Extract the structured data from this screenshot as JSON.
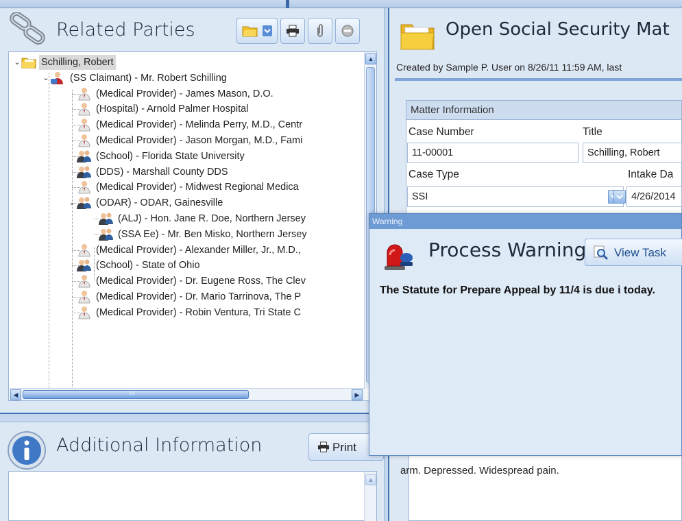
{
  "related_parties": {
    "title": "Related Parties",
    "rows": [
      {
        "label": "Schilling, Robert",
        "level": 0,
        "icon": "folder-icon",
        "expanded": true,
        "selected": true
      },
      {
        "label": "(SS Claimant) - Mr. Robert Schilling",
        "level": 1,
        "icon": "claimant-icon",
        "expanded": true
      },
      {
        "label": "(Medical Provider) - James Mason, D.O.",
        "level": 2,
        "icon": "doctor-icon"
      },
      {
        "label": "(Hospital) - Arnold Palmer Hospital",
        "level": 2,
        "icon": "doctor-icon"
      },
      {
        "label": "(Medical Provider) - Melinda Perry, M.D., Centr",
        "level": 2,
        "icon": "doctor-icon"
      },
      {
        "label": "(Medical Provider) - Jason Morgan, M.D., Fami",
        "level": 2,
        "icon": "doctor-icon"
      },
      {
        "label": "(School) - Florida State University",
        "level": 2,
        "icon": "organization-icon"
      },
      {
        "label": "(DDS) - Marshall County DDS",
        "level": 2,
        "icon": "organization-icon"
      },
      {
        "label": "(Medical Provider) - Midwest Regional Medica",
        "level": 2,
        "icon": "doctor-icon"
      },
      {
        "label": "(ODAR) - ODAR, Gainesville",
        "level": 2,
        "icon": "organization-icon",
        "expanded": true
      },
      {
        "label": "(ALJ) - Hon. Jane R. Doe, Northern Jersey",
        "level": 3,
        "icon": "organization-icon"
      },
      {
        "label": "(SSA Ee) - Mr. Ben Misko, Northern Jersey",
        "level": 3,
        "icon": "organization-icon"
      },
      {
        "label": "(Medical Provider) - Alexander Miller, Jr., M.D.,",
        "level": 2,
        "icon": "doctor-icon"
      },
      {
        "label": "(School) - State of Ohio",
        "level": 2,
        "icon": "organization-icon"
      },
      {
        "label": "(Medical Provider) - Dr. Eugene Ross, The Clev",
        "level": 2,
        "icon": "doctor-icon"
      },
      {
        "label": "(Medical Provider) - Dr. Mario Tarrinova, The P",
        "level": 2,
        "icon": "doctor-icon"
      },
      {
        "label": "(Medical Provider) - Robin Ventura, Tri State C",
        "level": 2,
        "icon": "doctor-icon"
      }
    ],
    "hscroll_mark": "III"
  },
  "additional_info": {
    "title": "Additional Information",
    "print_label": "Print"
  },
  "matter": {
    "title": "Open Social Security Mat",
    "created": "Created by Sample P. User on 8/26/11 11:59 AM, last",
    "section_label": "Matter Information",
    "case_number_label": "Case Number",
    "case_number": "11-00001",
    "title_label": "Title",
    "title_value": "Schilling, Robert",
    "case_type_label": "Case Type",
    "case_type": "SSI",
    "intake_label": "Intake Da",
    "intake_value": "4/26/2014",
    "notes_text": "arm.  Depressed.  Widespread pain."
  },
  "warning": {
    "window_title": "Warning",
    "heading": "Process Warning",
    "view_task_label": "View Task",
    "message": "The Statute for Prepare Appeal by 11/4 is due i today."
  }
}
